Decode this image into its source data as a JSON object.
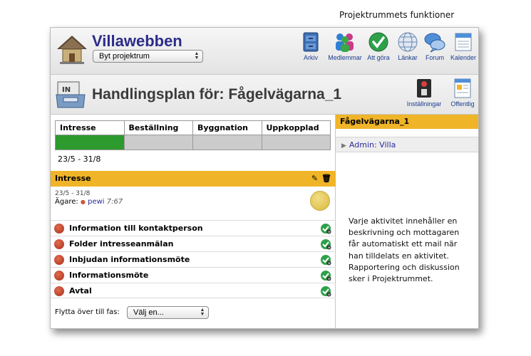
{
  "caption_top": "Projektrummets funktioner",
  "header": {
    "site_title": "Villawebben",
    "project_select": "Byt projektrum",
    "nav": [
      {
        "label": "Arkiv",
        "icon": "archive-icon"
      },
      {
        "label": "Medlemmar",
        "icon": "members-icon"
      },
      {
        "label": "Att göra",
        "icon": "todo-check-icon"
      },
      {
        "label": "Länkar",
        "icon": "links-globe-icon"
      },
      {
        "label": "Forum",
        "icon": "forum-bubbles-icon"
      },
      {
        "label": "Kalender",
        "icon": "calendar-icon"
      }
    ]
  },
  "titlebar": {
    "title": "Handlingsplan för: Fågelvägarna_1",
    "icon_text": "IN",
    "actions": [
      {
        "label": "Inställningar",
        "icon": "settings-switch-icon"
      },
      {
        "label": "Offentlig",
        "icon": "public-page-icon"
      }
    ]
  },
  "phases": {
    "columns": [
      "Intresse",
      "Beställning",
      "Byggnation",
      "Uppkopplad"
    ],
    "completed": 1
  },
  "date_range": "23/5 - 31/8",
  "activity": {
    "section_title": "Intresse",
    "date_range": "23/5 - 31/8",
    "owner_label": "Ägare:",
    "owner_name": "pewi",
    "owner_time": "7:67"
  },
  "tasks": [
    "Information till kontaktperson",
    "Folder intresseanmälan",
    "Inbjudan informationsmöte",
    "Informationsmöte",
    "Avtal"
  ],
  "move": {
    "label": "Flytta över till fas:",
    "select": "Välj en..."
  },
  "right": {
    "title": "Fågelvägarna_1",
    "admin": "Admin: Villa"
  },
  "side_note": "Varje aktivitet innehåller en beskrivning och mottagaren får automatiskt ett mail när han tilldelats en aktivitet. Rapportering och diskussion sker i Projektrummet.",
  "colors": {
    "accent": "#f0b428",
    "phase_done": "#2c9a2c",
    "title_blue": "#2c2c8a",
    "link_blue": "#1a3d8f"
  }
}
